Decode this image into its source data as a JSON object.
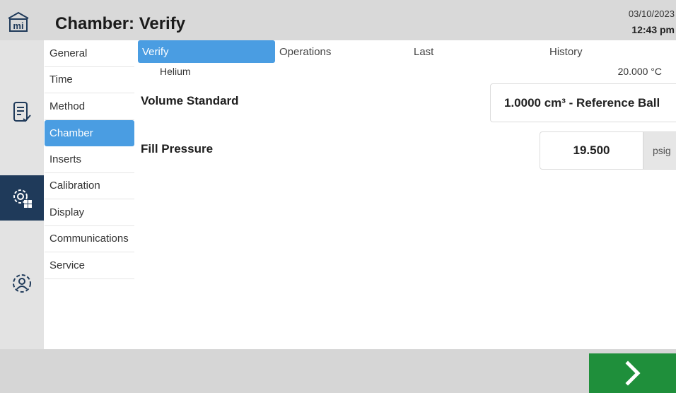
{
  "header": {
    "title": "Chamber: Verify",
    "date": "03/10/2023",
    "time": "12:43 pm"
  },
  "rail": {
    "items": [
      {
        "icon": "home-icon"
      },
      {
        "icon": "report-icon"
      },
      {
        "icon": "settings-grid-icon",
        "active": true
      },
      {
        "icon": "user-settings-icon"
      }
    ]
  },
  "settings_list": {
    "items": [
      {
        "label": "General"
      },
      {
        "label": "Time"
      },
      {
        "label": "Method"
      },
      {
        "label": "Chamber",
        "active": true
      },
      {
        "label": "Inserts"
      },
      {
        "label": "Calibration"
      },
      {
        "label": "Display"
      },
      {
        "label": "Communications"
      },
      {
        "label": "Service"
      }
    ]
  },
  "tabs": [
    {
      "label": "Verify",
      "active": true
    },
    {
      "label": "Operations"
    },
    {
      "label": "Last"
    },
    {
      "label": "History"
    }
  ],
  "info": {
    "gas": "Helium",
    "temperature": "20.000 °C"
  },
  "fields": {
    "volume_label": "Volume Standard",
    "volume_value": "1.0000 cm³ - Reference Ball",
    "pressure_label": "Fill Pressure",
    "pressure_value": "19.500",
    "pressure_unit": "psig"
  },
  "colors": {
    "accent": "#4a9de2",
    "rail_active": "#1f3a5a",
    "next_button": "#1f8f3b"
  }
}
